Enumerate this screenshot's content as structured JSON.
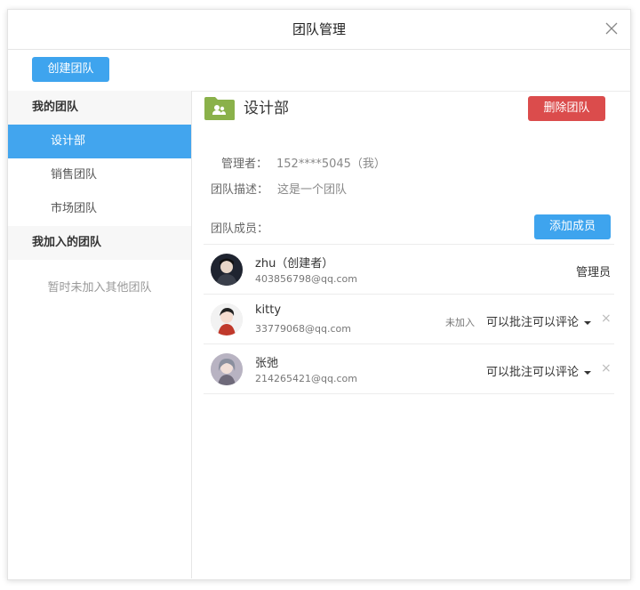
{
  "dialog": {
    "title": "团队管理"
  },
  "toolbar": {
    "create_label": "创建团队"
  },
  "sidebar": {
    "my_teams_label": "我的团队",
    "my_teams": [
      {
        "label": "设计部",
        "active": true
      },
      {
        "label": "销售团队",
        "active": false
      },
      {
        "label": "市场团队",
        "active": false
      }
    ],
    "joined_teams_label": "我加入的团队",
    "joined_empty_text": "暂时未加入其他团队"
  },
  "team": {
    "name": "设计部",
    "delete_label": "删除团队",
    "manager_label": "管理者：",
    "manager_value": "152****5045（我）",
    "desc_label": "团队描述：",
    "desc_value": "这是一个团队",
    "members_label": "团队成员：",
    "add_member_label": "添加成员"
  },
  "members": [
    {
      "name": "zhu（创建者）",
      "email": "403856798@qq.com",
      "role": "管理员",
      "status": "",
      "permission": ""
    },
    {
      "name": "kitty",
      "email": "33779068@qq.com",
      "role": "",
      "status": "未加入",
      "permission": "可以批注可以评论"
    },
    {
      "name": "张弛",
      "email": "214265421@qq.com",
      "role": "",
      "status": "",
      "permission": "可以批注可以评论"
    }
  ],
  "icons": {
    "close": "close-icon",
    "folder": "team-folder-icon",
    "caret": "caret-down-icon",
    "remove": "remove-icon"
  },
  "colors": {
    "accent_blue": "#3ea4ee",
    "danger_red": "#db4c4c",
    "folder_green": "#8ab14a"
  }
}
